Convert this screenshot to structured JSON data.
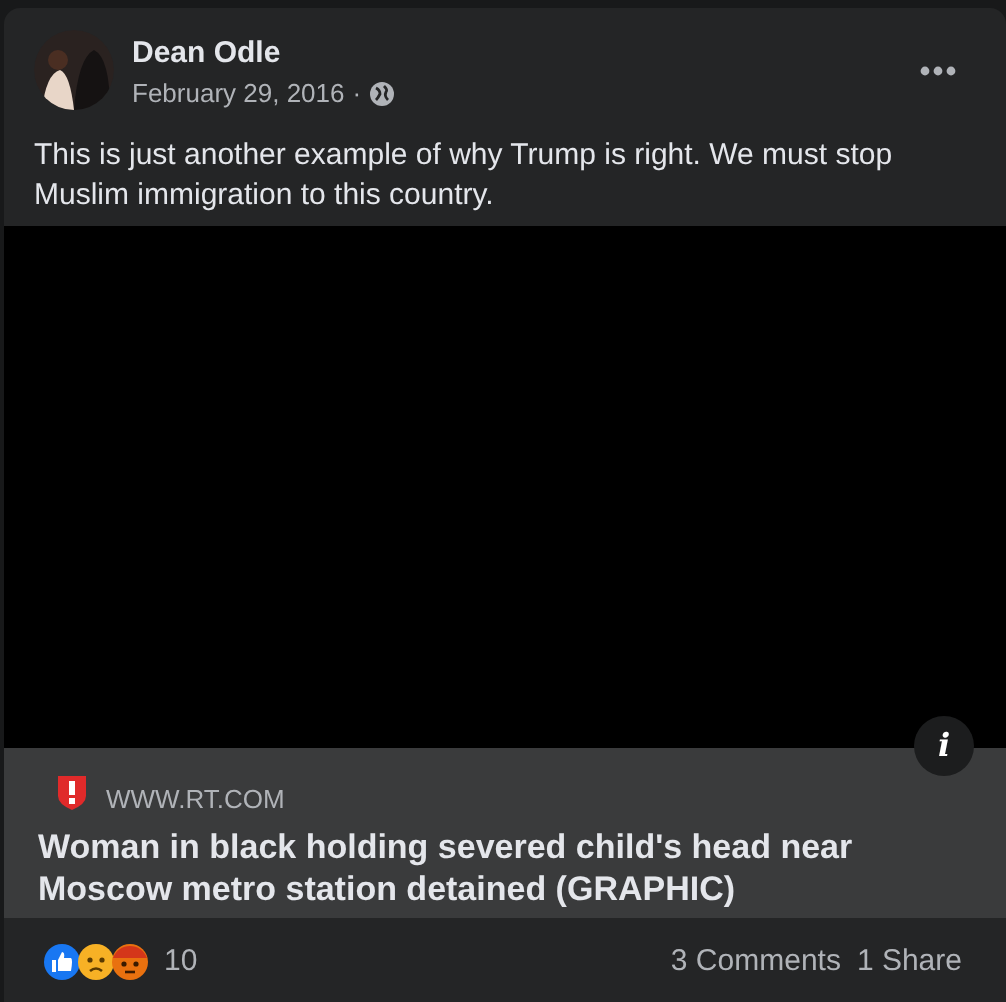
{
  "post": {
    "author": "Dean Odle",
    "date": "February 29, 2016",
    "separator": "·",
    "text": "This is just another example of why Trump is right. We must stop Muslim immigration to this country."
  },
  "link_preview": {
    "domain": "WWW.RT.COM",
    "title": "Woman in black holding severed child's head near Moscow metro station detained (GRAPHIC)",
    "info_button": "i"
  },
  "footer": {
    "reaction_count": "10",
    "comments": "3 Comments",
    "shares": "1 Share"
  }
}
